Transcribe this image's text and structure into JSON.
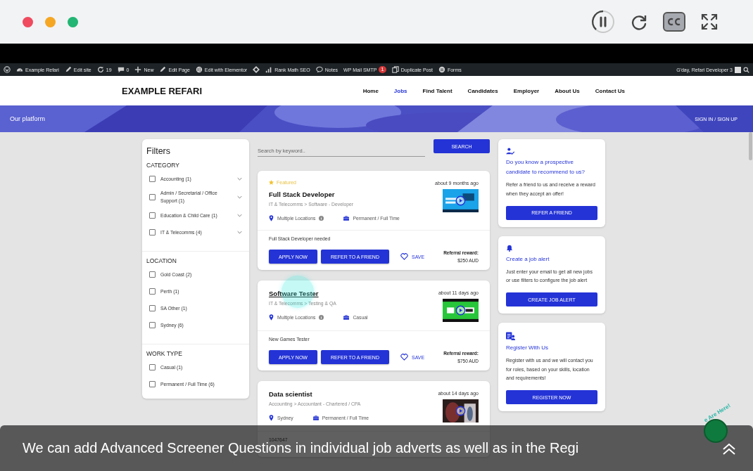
{
  "player": {
    "controls": [
      {
        "kind": "pause"
      },
      {
        "kind": "reload"
      },
      {
        "kind": "cc",
        "on": true
      },
      {
        "kind": "fullscreen"
      }
    ]
  },
  "admin_bar": {
    "items": [
      {
        "kind": "wp"
      },
      {
        "kind": "home",
        "label": "Example Refari"
      },
      {
        "kind": "edit",
        "label": "Edit site"
      },
      {
        "kind": "updates",
        "label": "19"
      },
      {
        "kind": "comments",
        "label": "0"
      },
      {
        "kind": "plus",
        "label": "New"
      },
      {
        "kind": "edit",
        "label": "Edit Page"
      },
      {
        "kind": "round",
        "label": "Edit with Elementor"
      },
      {
        "kind": "diamond"
      },
      {
        "kind": "chart",
        "label": "Rank Math SEO"
      },
      {
        "kind": "notes",
        "label": "Notes"
      },
      {
        "kind": "mail",
        "label": "WP Mail SMTP",
        "badge": "1"
      },
      {
        "kind": "copy",
        "label": "Duplicate Post"
      },
      {
        "kind": "forms",
        "label": "Forms"
      }
    ],
    "greeting": "G'day, Refari Developer 3"
  },
  "site": {
    "logo": "EXAMPLE REFARI",
    "nav": [
      {
        "label": "Home",
        "selected": false
      },
      {
        "label": "Jobs",
        "selected": true
      },
      {
        "label": "Find Talent",
        "selected": false
      },
      {
        "label": "Candidates",
        "selected": false
      },
      {
        "label": "Employer",
        "selected": false
      },
      {
        "label": "About Us",
        "selected": false
      },
      {
        "label": "Contact Us",
        "selected": false
      }
    ]
  },
  "banner": {
    "title": "Our platform",
    "link": "SIGN IN / SIGN UP"
  },
  "filters": {
    "title": "Filters",
    "groups": [
      {
        "heading": "CATEGORY",
        "options": [
          {
            "label": "Accounting (1)",
            "checked": false,
            "expandable": true
          },
          {
            "label": "Admin / Secretarial / Office Support (1)",
            "checked": false,
            "expandable": true
          },
          {
            "label": "Education & Child Care (1)",
            "checked": false,
            "expandable": true
          },
          {
            "label": "IT & Telecomms (4)",
            "checked": false,
            "expandable": true
          }
        ]
      },
      {
        "heading": "LOCATION",
        "options": [
          {
            "label": "Gold Coast (2)",
            "checked": false,
            "expandable": false
          },
          {
            "label": "Perth (1)",
            "checked": false,
            "expandable": false
          },
          {
            "label": "SA Other (1)",
            "checked": false,
            "expandable": false
          },
          {
            "label": "Sydney (6)",
            "checked": false,
            "expandable": false
          }
        ]
      },
      {
        "heading": "WORK TYPE",
        "options": [
          {
            "label": "Casual (1)",
            "checked": false,
            "expandable": false
          },
          {
            "label": "Permanent / Full Time (6)",
            "checked": false,
            "expandable": false
          }
        ]
      }
    ]
  },
  "search": {
    "placeholder": "Search by keyword..",
    "button": "SEARCH"
  },
  "jobs": [
    {
      "featured": "Featured",
      "title": "Full Stack Developer",
      "age": "about 9 months ago",
      "category": "IT & Telecomms > Software - Developer",
      "location": "Multiple Locations",
      "location_info": true,
      "work_type": "Permanent / Full Time",
      "description": "Full Stack Developer needed",
      "actions": {
        "apply": "APPLY NOW",
        "refer": "REFER TO A FRIEND",
        "save": "SAVE"
      },
      "reward_label": "Referral reward:",
      "reward": "$250 AUD"
    },
    {
      "title": "Software Tester",
      "age": "about 11 days ago",
      "category": "IT & Telecomms > Testing & QA",
      "location": "Multiple Locations",
      "location_info": true,
      "work_type": "Casual",
      "description": "New Games Tester",
      "actions": {
        "apply": "APPLY NOW",
        "refer": "REFER TO A FRIEND",
        "save": "SAVE"
      },
      "reward_label": "Referral reward:",
      "reward": "$750 AUD"
    },
    {
      "title": "Data scientist",
      "age": "about 14 days ago",
      "category": "Accounting > Accountant - Chartered / CPA",
      "location": "Sydney",
      "location_info": false,
      "work_type": "Permanent / Full Time",
      "description": "1047647"
    }
  ],
  "side_cards": [
    {
      "kind": "referral",
      "title": "Do you know a prospective candidate to recommend to us?",
      "text": "Refer a friend to us and receive a reward when they accept an offer!",
      "button": "REFER A FRIEND"
    },
    {
      "kind": "alert",
      "title": "Create a job alert",
      "text": "Just enter your email to get all new jobs or use filters to configure the job alert",
      "button": "CREATE JOB ALERT"
    },
    {
      "kind": "register",
      "title": "Register With Us",
      "text": "Register with us and we will contact you for roles, based on your skills, location and requirements!",
      "button": "REGISTER NOW"
    }
  ],
  "chat_widget": {
    "label": "e Are Here!"
  },
  "caption": {
    "text": "We can add Advanced Screener Questions in individual job adverts as well as in the Regi"
  }
}
